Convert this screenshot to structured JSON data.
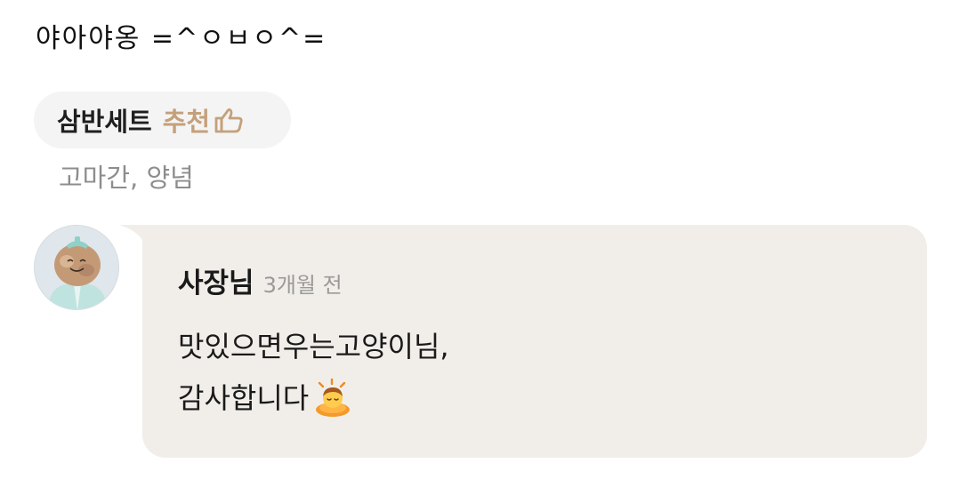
{
  "review": {
    "text": "야아야옹 =^ㅇㅂㅇ^="
  },
  "menu": {
    "name": "삼반세트",
    "recommend_label": "추천",
    "recommend_icon": "thumbs-up-icon",
    "options": "고마간, 양념"
  },
  "reply": {
    "author": "사장님",
    "time": "3개월 전",
    "line1": "맛있으면우는고양이님,",
    "line2": "감사합니다",
    "emoji": "person-bowing-icon"
  },
  "colors": {
    "chip_bg": "#f4f4f4",
    "recommend": "#c4a07a",
    "bubble_bg": "#f1eeea",
    "muted_text": "#8d8d8d"
  }
}
